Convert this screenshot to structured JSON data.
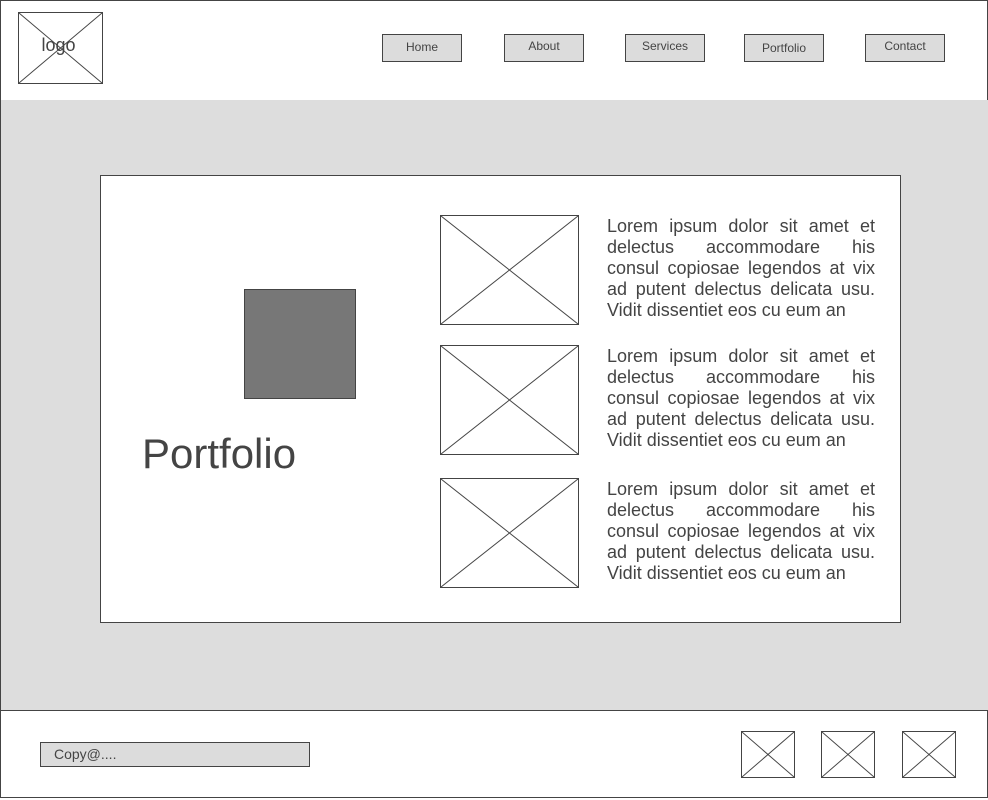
{
  "header": {
    "logo_label": "logo",
    "nav": [
      "Home",
      "About",
      "Services",
      "Portfolio",
      "Contact"
    ]
  },
  "main": {
    "title": "Portfolio",
    "items": [
      {
        "text": "Lorem ipsum dolor sit amet et delectus accommodare his consul copiosae legendos at vix ad putent delectus delicata usu. Vidit dissentiet eos cu eum an"
      },
      {
        "text": "Lorem ipsum dolor sit amet et delectus accommodare his consul copiosae legendos at vix ad putent delectus delicata usu. Vidit dissentiet eos cu eum an"
      },
      {
        "text": "Lorem ipsum dolor sit amet et delectus accommodare his consul copiosae legendos at vix ad putent delectus delicata usu. Vidit dissentiet eos cu eum an"
      }
    ]
  },
  "footer": {
    "copyright": "Copy@...."
  }
}
